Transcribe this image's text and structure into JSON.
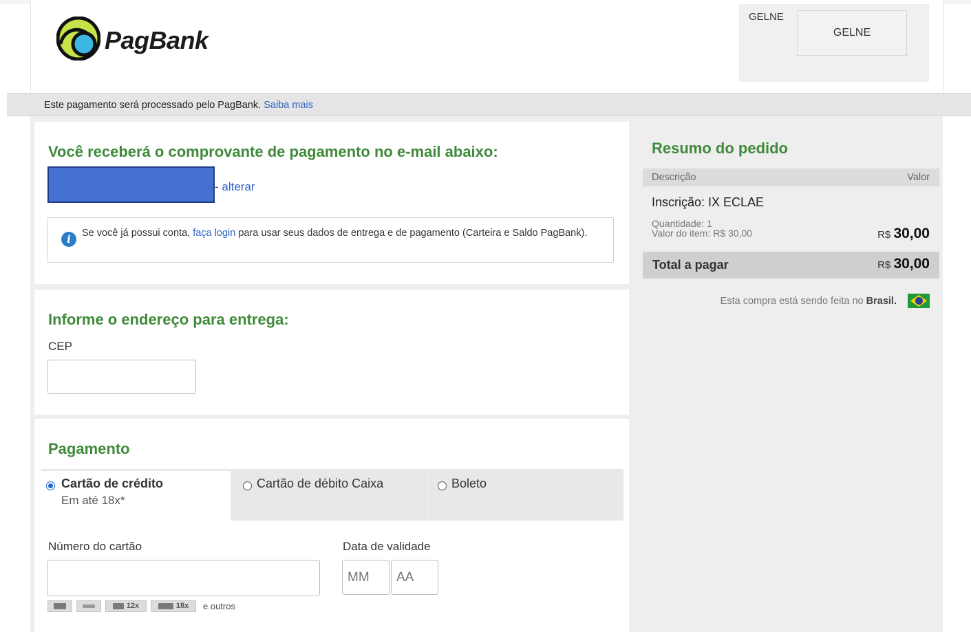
{
  "header": {
    "brand_name": "PagBank",
    "seller_name": "GELNE",
    "seller_logo_text": "GELNE"
  },
  "infobar": {
    "text": "Este pagamento será processado pelo PagBank.",
    "link": "Saiba mais"
  },
  "email_section": {
    "title": "Você receberá o comprovante de pagamento no e-mail abaixo:",
    "change_link": "alterar",
    "notice_prefix": "Se você já possui conta,",
    "notice_link": "faça login",
    "notice_suffix": "para usar seus dados de entrega e de pagamento (Carteira e Saldo PagBank)."
  },
  "address_section": {
    "title": "Informe o endereço para entrega:",
    "cep_label": "CEP",
    "cep_value": ""
  },
  "payment_section": {
    "title": "Pagamento",
    "tabs": [
      {
        "label": "Cartão de crédito",
        "sub": "Em até 18x*",
        "selected": true
      },
      {
        "label": "Cartão de débito Caixa",
        "selected": false
      },
      {
        "label": "Boleto",
        "selected": false
      }
    ],
    "card_number_label": "Número do cartão",
    "card_number_value": "",
    "expiry_label": "Data de validade",
    "expiry_month_placeholder": "MM",
    "expiry_year_placeholder": "AA",
    "brands": [
      "",
      "",
      "12x",
      "18x"
    ],
    "brands_more": "e outros"
  },
  "summary": {
    "title": "Resumo do pedido",
    "col_description": "Descrição",
    "col_value": "Valor",
    "item_name": "Inscrição: IX ECLAE",
    "item_quantity": "Quantidade: 1",
    "item_unit_value": "Valor do item: R$ 30,00",
    "currency": "R$",
    "item_total": "30,00",
    "total_label": "Total a pagar",
    "total_value": "30,00",
    "country_note_prefix": "Esta compra está sendo feita no",
    "country": "Brasil."
  },
  "colors": {
    "accent_green": "#3f8a3a",
    "link_blue": "#2f62c4",
    "radio_blue": "#1f66d9"
  }
}
